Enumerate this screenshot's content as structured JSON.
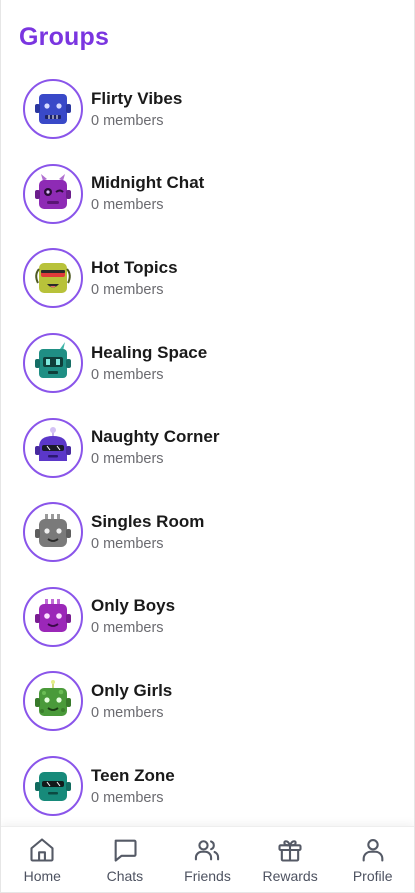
{
  "header": {
    "title": "Groups"
  },
  "groups": [
    {
      "name": "Flirty Vibes",
      "members": "0 members",
      "icon": "blue-robot-icon",
      "color": "#3949c8"
    },
    {
      "name": "Midnight Chat",
      "members": "0 members",
      "icon": "purple-horned-robot-icon",
      "color": "#8e2bb5"
    },
    {
      "name": "Hot Topics",
      "members": "0 members",
      "icon": "yellow-visor-robot-icon",
      "color": "#b8c23a"
    },
    {
      "name": "Healing Space",
      "members": "0 members",
      "icon": "teal-robot-icon",
      "color": "#1f8f84"
    },
    {
      "name": "Naughty Corner",
      "members": "0 members",
      "icon": "indigo-antenna-robot-icon",
      "color": "#5b37c9"
    },
    {
      "name": "Singles Room",
      "members": "0 members",
      "icon": "gray-robot-icon",
      "color": "#7a7a7a"
    },
    {
      "name": "Only Boys",
      "members": "0 members",
      "icon": "magenta-robot-icon",
      "color": "#9b27b8"
    },
    {
      "name": "Only Girls",
      "members": "0 members",
      "icon": "green-robot-icon",
      "color": "#4a9a3a"
    },
    {
      "name": "Teen Zone",
      "members": "0 members",
      "icon": "teal-shades-robot-icon",
      "color": "#178a7a"
    }
  ],
  "nav": [
    {
      "label": "Home",
      "icon": "home-icon"
    },
    {
      "label": "Chats",
      "icon": "chat-bubble-icon"
    },
    {
      "label": "Friends",
      "icon": "users-icon"
    },
    {
      "label": "Rewards",
      "icon": "gift-icon"
    },
    {
      "label": "Profile",
      "icon": "user-icon"
    }
  ]
}
